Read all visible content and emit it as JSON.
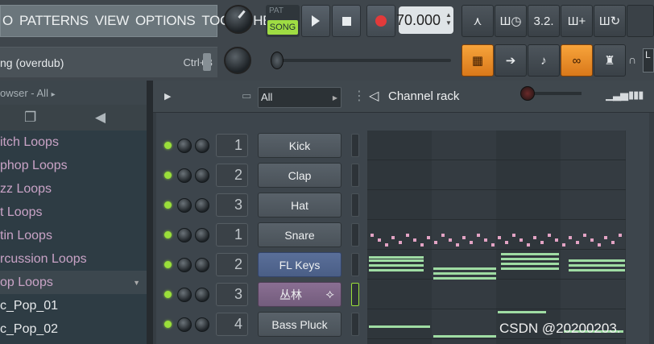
{
  "menu": {
    "items": [
      "O",
      "PATTERNS",
      "VIEW",
      "OPTIONS",
      "TOOLS",
      "HELP"
    ]
  },
  "hint": {
    "text": "ng (overdub)",
    "shortcut": "Ctrl+B"
  },
  "transport": {
    "pat_label": "PAT",
    "song_label": "SONG",
    "tempo": "70.000"
  },
  "toolbar": {
    "icons": [
      "metronome-icon",
      "wait-icon",
      "countdown-icon",
      "step-edit-icon",
      "loop-record-icon",
      "typing-keyboard-icon",
      "arrow-icon",
      "wand-icon",
      "link-icon",
      "mixer-icon"
    ],
    "countdown_label": "3.2."
  },
  "browser": {
    "header": "owser - All",
    "items": [
      {
        "label": "itch Loops",
        "type": "folder"
      },
      {
        "label": "phop Loops",
        "type": "folder"
      },
      {
        "label": "zz Loops",
        "type": "folder"
      },
      {
        "label": "t Loops",
        "type": "folder"
      },
      {
        "label": "tin Loops",
        "type": "folder"
      },
      {
        "label": "rcussion Loops",
        "type": "folder"
      },
      {
        "label": "op Loops",
        "type": "folder"
      },
      {
        "label": "c_Pop_01",
        "type": "file"
      },
      {
        "label": "c_Pop_02",
        "type": "file"
      }
    ]
  },
  "rack": {
    "filter": "All",
    "title": "Channel rack",
    "channels": [
      {
        "num": "1",
        "name": "Kick",
        "style": "normal"
      },
      {
        "num": "2",
        "name": "Clap",
        "style": "normal"
      },
      {
        "num": "3",
        "name": "Hat",
        "style": "normal"
      },
      {
        "num": "1",
        "name": "Snare",
        "style": "normal"
      },
      {
        "num": "2",
        "name": "FL Keys",
        "style": "blue"
      },
      {
        "num": "3",
        "name": "丛林",
        "style": "purple"
      },
      {
        "num": "4",
        "name": "Bass Pluck",
        "style": "normal"
      }
    ]
  },
  "watermark": "CSDN @20200203.",
  "colors": {
    "accent_green": "#9adf3a",
    "orange": "#f7a43b",
    "note_green": "#9fdca3",
    "note_pink": "#e3a3c4"
  }
}
